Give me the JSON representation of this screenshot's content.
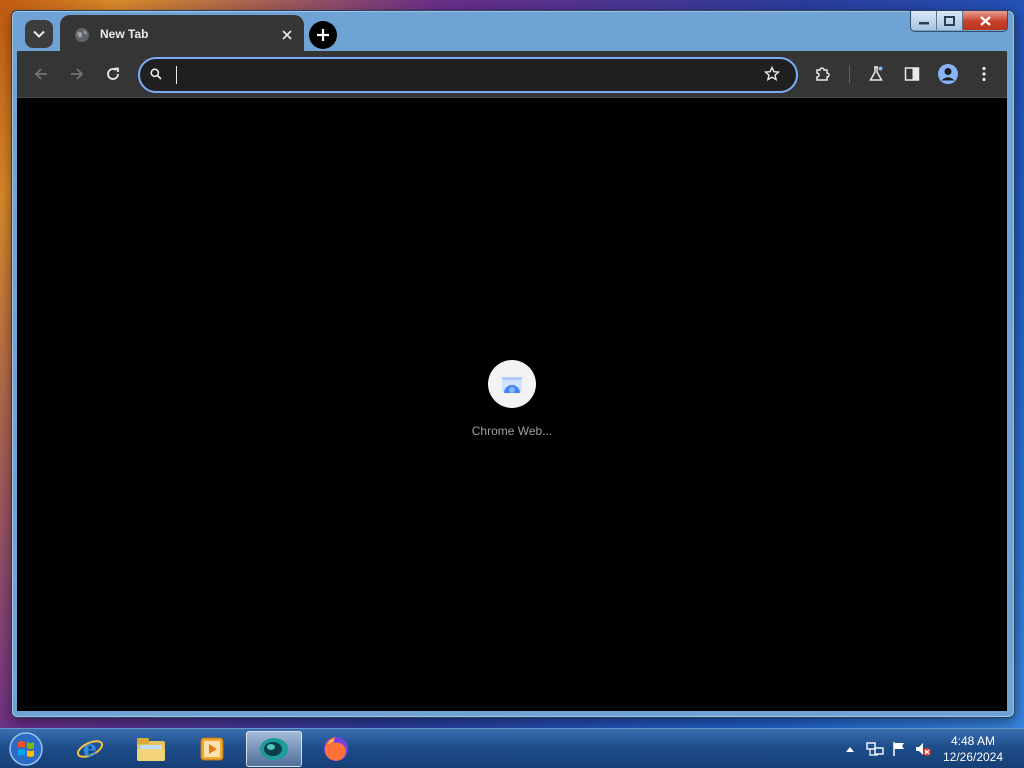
{
  "browser": {
    "tab": {
      "title": "New Tab"
    },
    "omnibox": {
      "value": "",
      "placeholder": ""
    },
    "new_tab_page": {
      "shortcuts": [
        {
          "label": "Chrome Web..."
        }
      ]
    },
    "colors": {
      "frame": "#353535",
      "content_background": "#000000",
      "omnibox_focus": "#7cacf8"
    }
  },
  "taskbar": {
    "pinned": [
      "internet-explorer-icon",
      "file-explorer-icon",
      "media-player-icon",
      "browser-app-icon",
      "firefox-icon"
    ],
    "clock": {
      "time": "4:48 AM",
      "date": "12/26/2024"
    }
  }
}
